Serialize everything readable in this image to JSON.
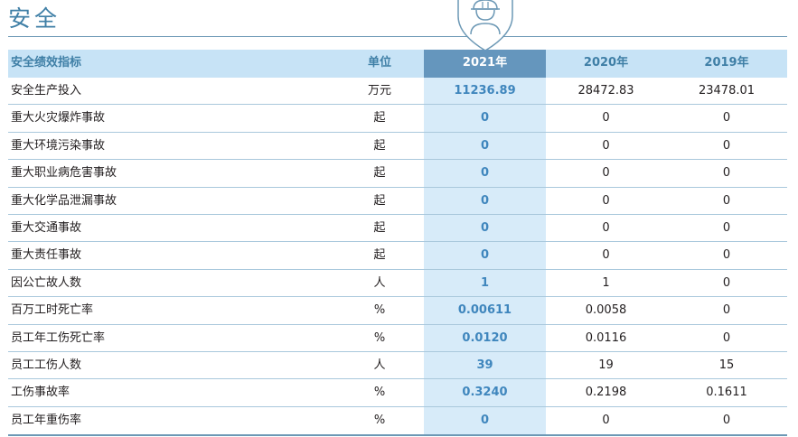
{
  "section_title": "安全",
  "table": {
    "headers": {
      "indicator": "安全绩效指标",
      "unit": "单位",
      "y2021": "2021年",
      "y2020": "2020年",
      "y2019": "2019年"
    },
    "rows": [
      {
        "name": "安全生产投入",
        "unit": "万元",
        "y2021": "11236.89",
        "y2020": "28472.83",
        "y2019": "23478.01"
      },
      {
        "name": "重大火灾爆炸事故",
        "unit": "起",
        "y2021": "0",
        "y2020": "0",
        "y2019": "0"
      },
      {
        "name": "重大环境污染事故",
        "unit": "起",
        "y2021": "0",
        "y2020": "0",
        "y2019": "0"
      },
      {
        "name": "重大职业病危害事故",
        "unit": "起",
        "y2021": "0",
        "y2020": "0",
        "y2019": "0"
      },
      {
        "name": "重大化学品泄漏事故",
        "unit": "起",
        "y2021": "0",
        "y2020": "0",
        "y2019": "0"
      },
      {
        "name": "重大交通事故",
        "unit": "起",
        "y2021": "0",
        "y2020": "0",
        "y2019": "0"
      },
      {
        "name": "重大责任事故",
        "unit": "起",
        "y2021": "0",
        "y2020": "0",
        "y2019": "0"
      },
      {
        "name": "因公亡故人数",
        "unit": "人",
        "y2021": "1",
        "y2020": "1",
        "y2019": "0"
      },
      {
        "name": "百万工时死亡率",
        "unit": "%",
        "y2021": "0.00611",
        "y2020": "0.0058",
        "y2019": "0"
      },
      {
        "name": "员工年工伤死亡率",
        "unit": "%",
        "y2021": "0.0120",
        "y2020": "0.0116",
        "y2019": "0"
      },
      {
        "name": "员工工伤人数",
        "unit": "人",
        "y2021": "39",
        "y2020": "19",
        "y2019": "15"
      },
      {
        "name": "工伤事故率",
        "unit": "%",
        "y2021": "0.3240",
        "y2020": "0.2198",
        "y2019": "0.1611"
      },
      {
        "name": "员工年重伤率",
        "unit": "%",
        "y2021": "0",
        "y2020": "0",
        "y2019": "0"
      }
    ]
  },
  "icons": {
    "badge": "safety-worker-icon"
  },
  "colors": {
    "title": "#3f7fa6",
    "header_bg": "#c7e3f6",
    "highlight_header": "#6596bd",
    "highlight_column": "#d7ebf9",
    "highlight_value": "#3f86bd"
  }
}
